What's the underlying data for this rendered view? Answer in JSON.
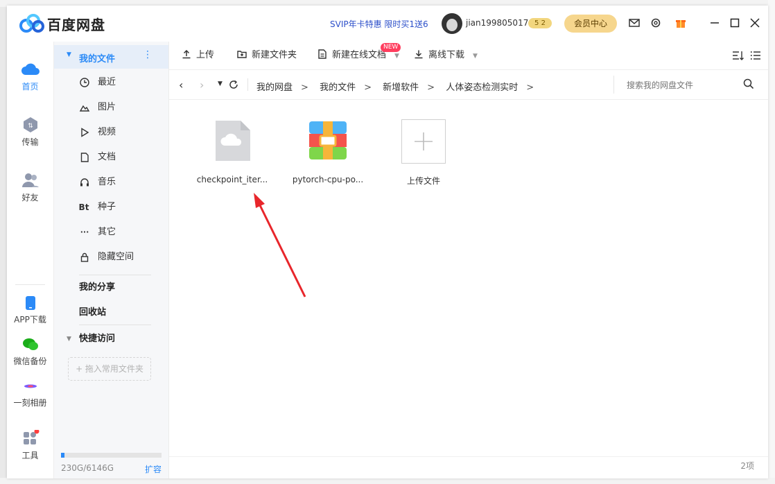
{
  "app": {
    "brand": "百度网盘"
  },
  "header": {
    "promo": "SVIP年卡特惠 限时买1送6",
    "username": "jian199805017",
    "level_badge": "5 2",
    "vip_button": "会员中心"
  },
  "rail": {
    "items": [
      {
        "label": "首页"
      },
      {
        "label": "传输"
      },
      {
        "label": "好友"
      },
      {
        "label": "APP下载"
      },
      {
        "label": "微信备份"
      },
      {
        "label": "一刻相册"
      },
      {
        "label": "工具"
      }
    ]
  },
  "sidebar": {
    "my_files": "我的文件",
    "items": [
      {
        "label": "最近",
        "icon": "clock-icon"
      },
      {
        "label": "图片",
        "icon": "image-icon"
      },
      {
        "label": "视频",
        "icon": "play-icon"
      },
      {
        "label": "文档",
        "icon": "document-icon"
      },
      {
        "label": "音乐",
        "icon": "headphones-icon"
      },
      {
        "label": "种子",
        "icon": "bt-icon",
        "glyph": "Bt"
      },
      {
        "label": "其它",
        "icon": "more-icon",
        "glyph": "···"
      },
      {
        "label": "隐藏空间",
        "icon": "lock-icon"
      }
    ],
    "my_share": "我的分享",
    "recycle": "回收站",
    "quick_access": "快捷访问",
    "quick_drop": "+ 拖入常用文件夹",
    "storage_text": "230G/6146G",
    "storage_fraction": 0.037,
    "expand": "扩容"
  },
  "toolbar": {
    "upload": "上传",
    "new_folder": "新建文件夹",
    "new_online_doc": "新建在线文档",
    "new_badge": "NEW",
    "offline_download": "离线下载"
  },
  "breadcrumb": [
    "我的网盘",
    "我的文件",
    "新增软件",
    "人体姿态检测实时"
  ],
  "breadcrumb_sep": ">",
  "search": {
    "placeholder": "搜索我的网盘文件"
  },
  "files": [
    {
      "name": "checkpoint_iter...",
      "icon": "cloud-file-icon"
    },
    {
      "name": "pytorch-cpu-po...",
      "icon": "archive-icon"
    }
  ],
  "upload_tile": {
    "label": "上传文件"
  },
  "status": {
    "count": "2项"
  },
  "colors": {
    "accent": "#2b8af7",
    "vip": "#f6d68d",
    "annotation_arrow": "#e8262b"
  }
}
